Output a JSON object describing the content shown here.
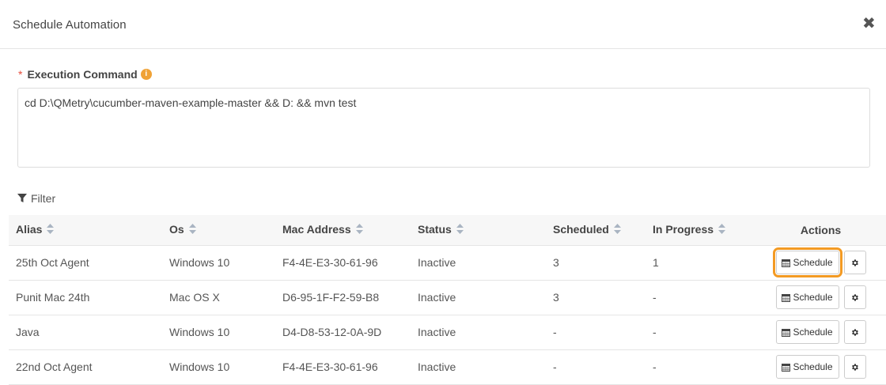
{
  "modal": {
    "title": "Schedule Automation",
    "close_glyph": "✖"
  },
  "form": {
    "execution_label": "Execution Command",
    "required_marker": "*",
    "info_icon": "info-circle-icon",
    "command_value": "cd D:\\QMetry\\cucumber-maven-example-master && D: && mvn test"
  },
  "filter": {
    "label": "Filter",
    "icon": "funnel-icon"
  },
  "table": {
    "headers": {
      "alias": "Alias",
      "os": "Os",
      "mac": "Mac Address",
      "status": "Status",
      "scheduled": "Scheduled",
      "in_progress": "In Progress",
      "actions": "Actions"
    },
    "schedule_label": "Schedule",
    "rows": [
      {
        "alias": "25th Oct Agent",
        "os": "Windows 10",
        "mac": "F4-4E-E3-30-61-96",
        "status": "Inactive",
        "scheduled": "3",
        "in_progress": "1"
      },
      {
        "alias": "Punit Mac 24th",
        "os": "Mac OS X",
        "mac": "D6-95-1F-F2-59-B8",
        "status": "Inactive",
        "scheduled": "3",
        "in_progress": "-"
      },
      {
        "alias": "Java",
        "os": "Windows 10",
        "mac": "D4-D8-53-12-0A-9D",
        "status": "Inactive",
        "scheduled": "-",
        "in_progress": "-"
      },
      {
        "alias": "22nd Oct Agent",
        "os": "Windows 10",
        "mac": "F4-4E-E3-30-61-96",
        "status": "Inactive",
        "scheduled": "-",
        "in_progress": "-"
      }
    ]
  },
  "colors": {
    "highlight": "#f39a23",
    "required": "#e74c3c",
    "info": "#f0a236"
  }
}
